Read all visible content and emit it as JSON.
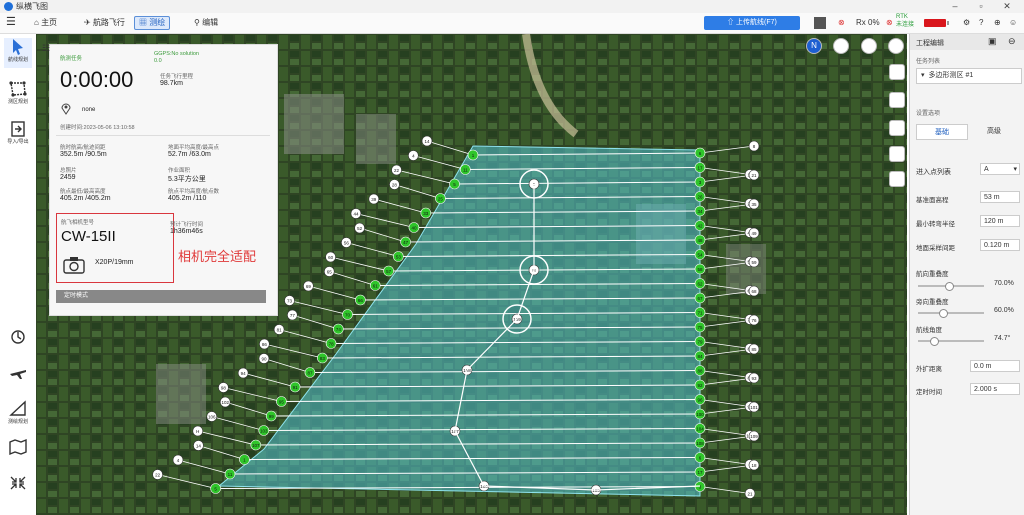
{
  "app": {
    "title": "纵横飞图"
  },
  "toolbar": {
    "home": "主页",
    "route_flight": "航路飞行",
    "survey": "测绘",
    "edit": "编辑",
    "upload": "上传航线(F7)",
    "rx": "Rx 0%",
    "rtk": "RTK",
    "rtk_sub": "未连接"
  },
  "leftbar": {
    "items": [
      "航线规划",
      "测区规划",
      "导入/导出",
      "",
      "",
      "测绘规划",
      "",
      ""
    ]
  },
  "info": {
    "flight_status": "航测任务",
    "gps": "GGPS:No solution",
    "gps_sub": "0.0",
    "time": "0:00:00",
    "est_time_label": "任务飞行里程",
    "est_time": "98.7km",
    "location": "none",
    "created": "创建时间:2023-05-06 13:10:58",
    "stats": [
      {
        "label": "航时航高/航迹间距",
        "value": "352.5m /90.5m"
      },
      {
        "label": "地面平均高度/最高点",
        "value": "52.7m /63.0m"
      },
      {
        "label": "总照片",
        "value": "2459"
      },
      {
        "label": "作业面积",
        "value": "5.3平方公里"
      },
      {
        "label": "航点最低/最高高度",
        "value": "405.2m /405.2m"
      },
      {
        "label": "航点平均高度/航点数",
        "value": "405.2m /110"
      }
    ],
    "camera_label": "航飞相机型号",
    "camera_model": "CW-15II",
    "lens": "X20P/19mm",
    "flight_time_label": "预计飞行时间",
    "flight_time": "1h36m46s",
    "mode_button": "定时模式",
    "annotation": "相机完全适配"
  },
  "right_panel": {
    "header": "工程编辑",
    "task_list_label": "任务列表",
    "task_name": "多边形测区 #1",
    "settings_label": "设置选项",
    "tab_basic": "基础",
    "tab_advanced": "高级",
    "entry_label": "进入点列表",
    "entry_value": "A",
    "fields": [
      {
        "label": "基准面高程",
        "value": "53 m"
      },
      {
        "label": "最小转弯半径",
        "value": "120 m"
      },
      {
        "label": "地面采样间距",
        "value": "0.120 m"
      }
    ],
    "sliders": [
      {
        "label": "航向重叠度",
        "value": "70.0%",
        "level": 0.45
      },
      {
        "label": "旁向重叠度",
        "value": "60.0%",
        "level": 0.35
      },
      {
        "label": "航线角度",
        "value": "74.7°",
        "level": 0.2
      }
    ],
    "fields2": [
      {
        "label": "外扩距离",
        "value": "0.0 m"
      },
      {
        "label": "定时时间",
        "value": "2.000 s"
      }
    ]
  },
  "map": {
    "waypoint_labels": [
      "1",
      "6",
      "8",
      "14",
      "11",
      "17",
      "18",
      "4",
      "5",
      "3",
      "21",
      "22",
      "25",
      "26",
      "27",
      "28",
      "33",
      "34",
      "35",
      "39",
      "40",
      "42",
      "43",
      "44",
      "47",
      "48",
      "49",
      "52",
      "53",
      "54",
      "55",
      "56",
      "57",
      "58",
      "59",
      "60",
      "61",
      "62",
      "64",
      "65",
      "66",
      "67",
      "68",
      "69",
      "70",
      "71",
      "72",
      "73",
      "74",
      "75",
      "76",
      "77",
      "78",
      "79",
      "80",
      "81",
      "83",
      "84",
      "85",
      "86",
      "87",
      "88",
      "89",
      "90",
      "91",
      "92",
      "93",
      "94",
      "95",
      "96",
      "97",
      "98",
      "99",
      "100",
      "101",
      "102",
      "103",
      "104",
      "105",
      "106",
      "107",
      "108",
      "109",
      "H"
    ],
    "colors": {
      "area": "#56c5d4",
      "line": "#ffffff",
      "green_node": "#2fc52a"
    }
  }
}
